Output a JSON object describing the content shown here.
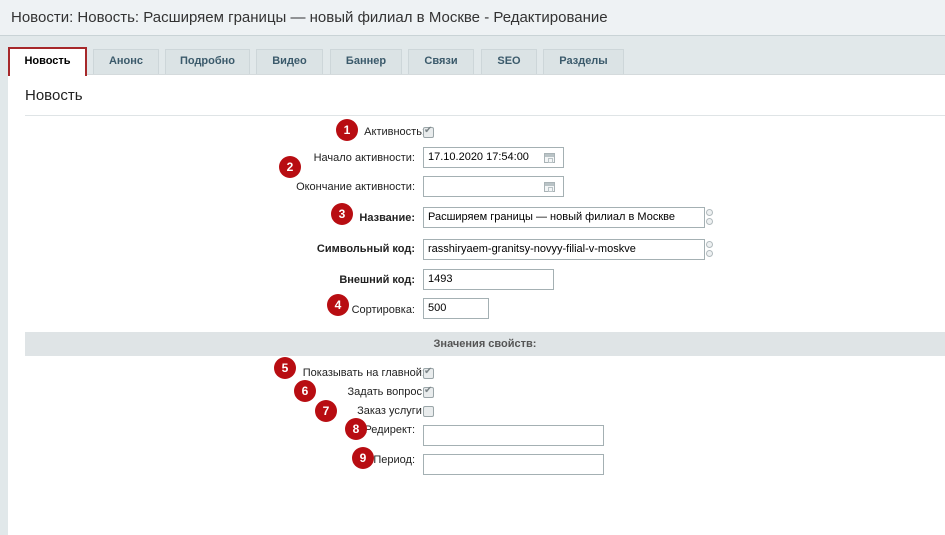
{
  "window": {
    "title": "Новости: Новость: Расширяем границы — новый филиал в Москве - Редактирование"
  },
  "tabs": [
    {
      "label": "Новость",
      "active": true
    },
    {
      "label": "Анонс",
      "active": false
    },
    {
      "label": "Подробно",
      "active": false
    },
    {
      "label": "Видео",
      "active": false
    },
    {
      "label": "Баннер",
      "active": false
    },
    {
      "label": "Связи",
      "active": false
    },
    {
      "label": "SEO",
      "active": false
    },
    {
      "label": "Разделы",
      "active": false
    }
  ],
  "panel": {
    "title": "Новость"
  },
  "form": {
    "active": {
      "label": "Активность:",
      "checked": true
    },
    "active_from": {
      "label": "Начало активности:",
      "value": "17.10.2020 17:54:00",
      "icon": "calendar-icon"
    },
    "active_to": {
      "label": "Окончание активности:",
      "value": "",
      "icon": "calendar-icon"
    },
    "name": {
      "label": "Название:",
      "value": "Расширяем границы — новый филиал в Москве"
    },
    "code": {
      "label": "Символьный код:",
      "value": "rasshiryaem-granitsy-novyy-filial-v-moskve"
    },
    "xml_id": {
      "label": "Внешний код:",
      "value": "1493"
    },
    "sort": {
      "label": "Сортировка:",
      "value": "500"
    }
  },
  "properties": {
    "header": "Значения свойств:",
    "show_main": {
      "label": "Показывать на главной:",
      "checked": true
    },
    "ask_question": {
      "label": "Задать вопрос:",
      "checked": true
    },
    "order_service": {
      "label": "Заказ услуги:",
      "checked": false
    },
    "redirect": {
      "label": "Редирект:",
      "value": ""
    },
    "period": {
      "label": "Период:",
      "value": ""
    }
  },
  "badges": [
    "1",
    "2",
    "3",
    "4",
    "5",
    "6",
    "7",
    "8",
    "9"
  ],
  "colors": {
    "badge": "#b80d12",
    "active_tab_border": "#a6282a",
    "tab_text": "#3b5a6b",
    "background": "#e1e8ea"
  }
}
